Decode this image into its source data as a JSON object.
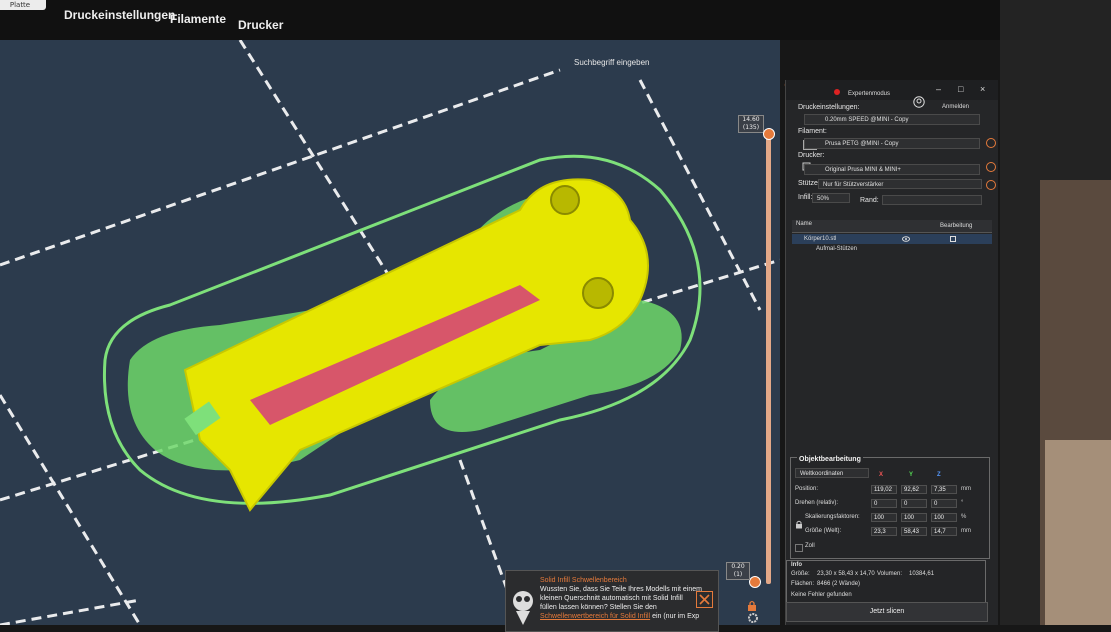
{
  "tabs": {
    "plate": "Platte",
    "print_settings": "Druckeinstellungen",
    "filaments": "Filamente",
    "printer": "Drucker"
  },
  "search": {
    "placeholder": "Suchbegriff eingeben"
  },
  "window": {
    "mode": "Expertenmodus",
    "login": "Anmelden",
    "minimize": "–",
    "maximize": "□",
    "close": "×"
  },
  "layer_slider": {
    "top_height": "14.60",
    "top_layer": "(135)",
    "bottom_height": "0.20",
    "bottom_layer": "(1)"
  },
  "panel": {
    "print_settings_label": "Druckeinstellungen:",
    "print_profile": "0.20mm SPEED @MINI - Copy",
    "filament_label": "Filament:",
    "filament_profile": "Prusa PETG @MINI - Copy",
    "filament_color": "#e9582a",
    "printer_label": "Drucker:",
    "printer_profile": "Original Prusa MINI & MINI+",
    "supports_label": "Stützen:",
    "supports_value": "Nur für Stützverstärker",
    "infill_label": "Infill:",
    "infill_value": "50%",
    "brim_label": "Rand:"
  },
  "object_list": {
    "col_name": "Name",
    "col_edit": "Bearbeitung",
    "rows": [
      {
        "name": "Körper10.stl"
      },
      {
        "name": "Aufmal-Stützen"
      }
    ]
  },
  "object_edit": {
    "title": "Objektbearbeitung",
    "coord_system": "Weltkoordinaten",
    "axes": [
      "X",
      "Y",
      "Z"
    ],
    "position_label": "Position:",
    "position": [
      "119,02",
      "92,62",
      "7,35"
    ],
    "position_unit": "mm",
    "rotate_label": "Drehen (relativ):",
    "rotate": [
      "0",
      "0",
      "0"
    ],
    "rotate_unit": "°",
    "scale_label": "Skalierungsfaktoren:",
    "scale": [
      "100",
      "100",
      "100"
    ],
    "scale_unit": "%",
    "size_label": "Größe (Welt):",
    "size": [
      "23,3",
      "58,43",
      "14,7"
    ],
    "size_unit": "mm",
    "inch_label": "Zoll"
  },
  "info": {
    "title": "Info",
    "size_label": "Größe:",
    "size_value": "23,30 x 58,43 x 14,70",
    "volume_label": "Volumen:",
    "volume_value": "10384,61",
    "facets_label": "Flächen:",
    "facets_value": "8466 (2 Wände)",
    "errors": "Keine Fehler gefunden"
  },
  "slice_button": "Jetzt slicen",
  "notification": {
    "title": "Solid Infill Schwellenbereich",
    "line1": "Wussten Sie, dass Sie Teile Ihres Modells mit einem",
    "line2": "kleinen Querschnitt automatisch mit Solid Infill",
    "line3": "füllen lassen können? Stellen Sie den",
    "link": "Schwellenwertbereich für Solid Infill",
    "line4_tail": "ein (nur im Exp"
  },
  "colors": {
    "accent": "#e57a3b",
    "model": "#e6e600",
    "skirt": "#7ee07a",
    "bed": "#2c3b4d"
  }
}
